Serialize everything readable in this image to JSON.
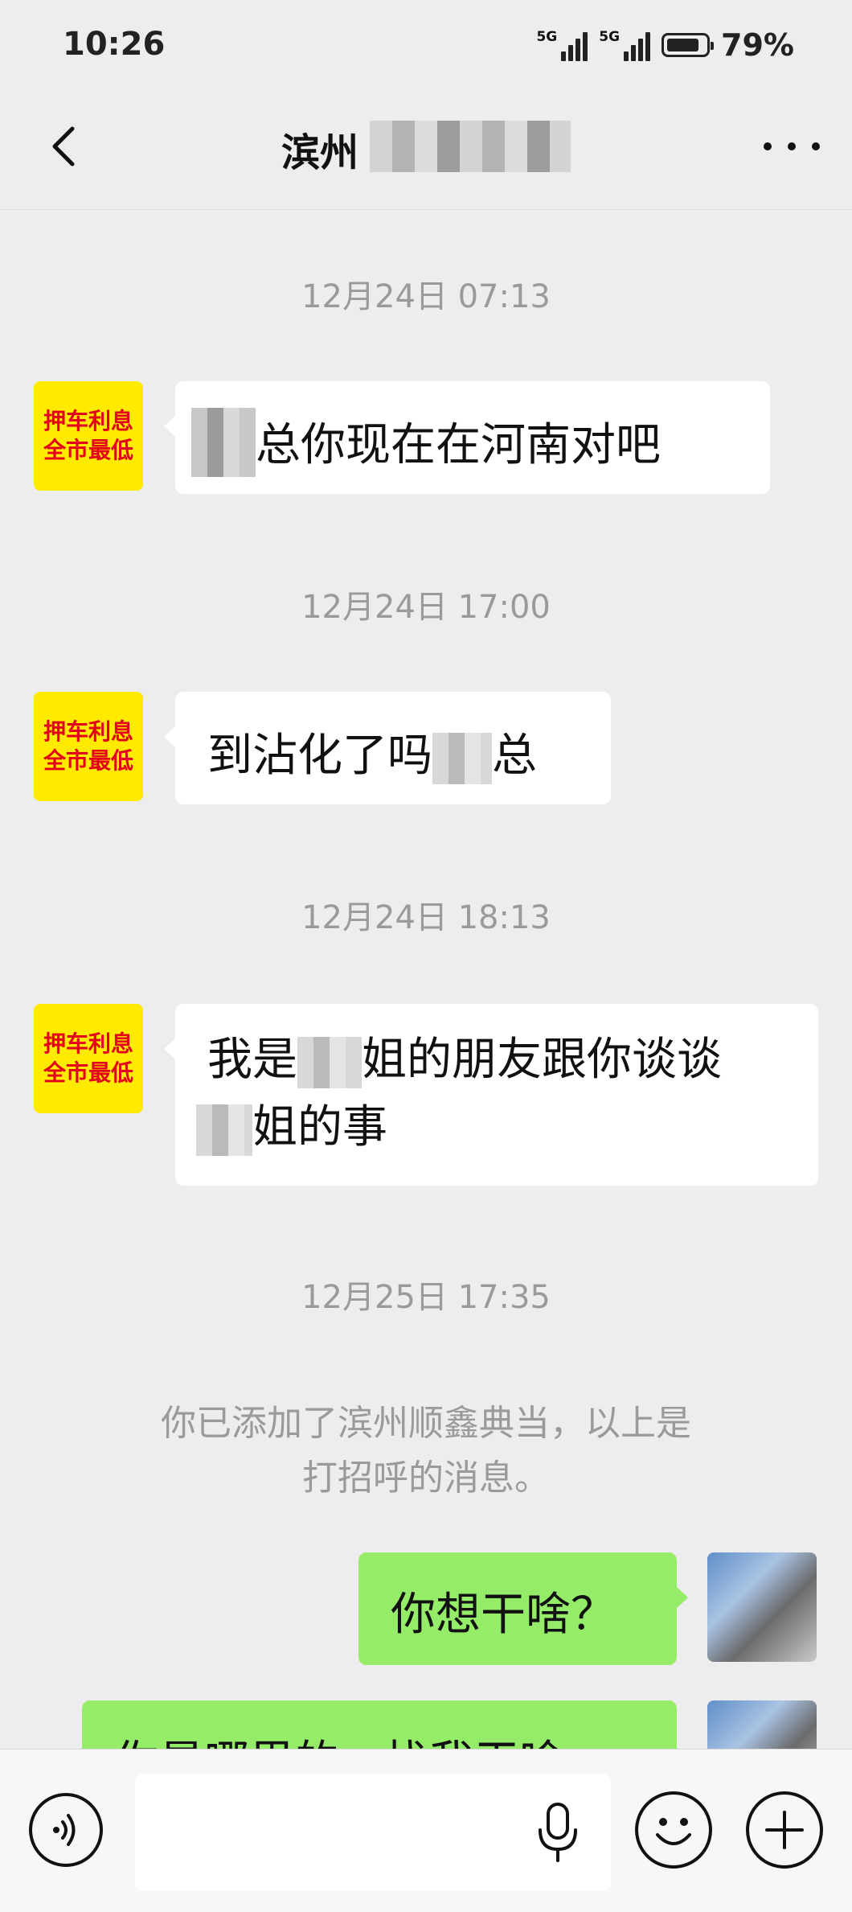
{
  "status_bar": {
    "time": "10:26",
    "network_1": "5G",
    "network_2": "5G",
    "battery": "79%"
  },
  "header": {
    "title": "滨州",
    "back_icon": "chevron-left-icon",
    "more_icon": "more-dots-icon"
  },
  "messages": [
    {
      "timestamp": "12月24日 07:13",
      "avatar_line1": "押车利息",
      "avatar_line2": "全市最低",
      "text": "总你现在在河南对吧"
    },
    {
      "timestamp": "12月24日 17:00",
      "avatar_line1": "押车利息",
      "avatar_line2": "全市最低",
      "text_before": "到沾化了吗",
      "text_after": "总"
    },
    {
      "timestamp": "12月24日 18:13",
      "avatar_line1": "押车利息",
      "avatar_line2": "全市最低",
      "line1_a": "我是",
      "line1_b": "姐的朋友跟你谈谈",
      "line2": "姐的事"
    }
  ],
  "timestamp_4": "12月25日 17:35",
  "system_note": {
    "line1": "你已添加了滨州顺鑫典当，以上是",
    "line2": "打招呼的消息。"
  },
  "outgoing": [
    {
      "text": "你想干啥？"
    },
    {
      "text": "你是哪里的，找我干啥"
    }
  ],
  "input_bar": {
    "voice_icon": "voice-wave-icon",
    "mic_icon": "microphone-icon",
    "emoji_icon": "emoji-smile-icon",
    "plus_icon": "plus-icon",
    "placeholder": ""
  }
}
